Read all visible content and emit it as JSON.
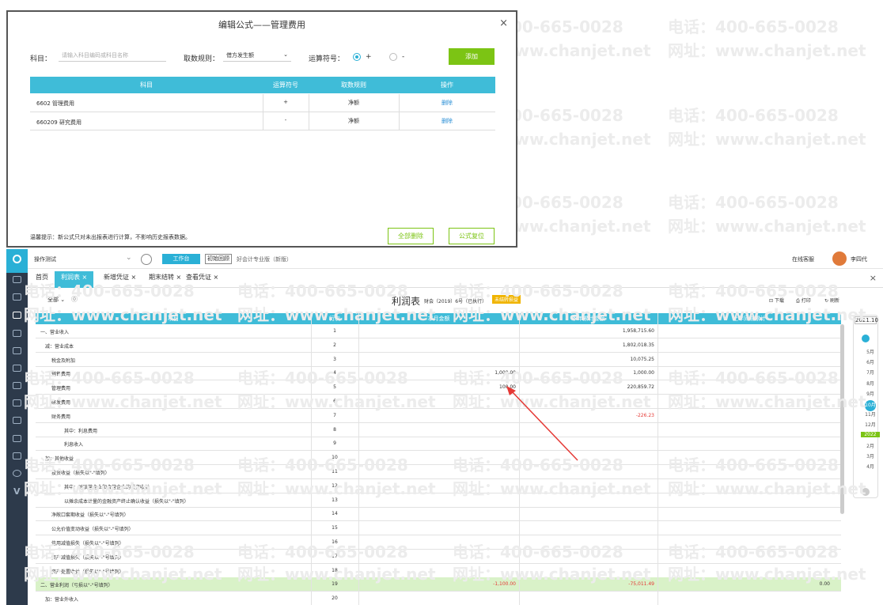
{
  "watermark": {
    "phone": "电话：400-665-0028",
    "site": "网址：www.chanjet.net"
  },
  "dialog": {
    "title": "编辑公式——管理费用",
    "close": "×",
    "subject_label": "科目：",
    "subject_placeholder": "请输入科目编码或科目名称",
    "rule_label": "取数规则：",
    "rule_value": "借方发生额",
    "op_label": "运算符号：",
    "op_plus": "+",
    "op_minus": "-",
    "add_button": "添加",
    "columns": [
      "科目",
      "运算符号",
      "取数规则",
      "操作"
    ],
    "rows": [
      {
        "subject": "6602 管理费用",
        "op": "+",
        "rule": "净额",
        "action": "删除"
      },
      {
        "subject": "660209 研究费用",
        "op": "-",
        "rule": "净额",
        "action": "删除"
      }
    ],
    "hint": "温馨提示：新公式只对未出报表进行计算，不影响历史报表数据。",
    "delete_all": "全部删除",
    "reset_formula": "公式复位"
  },
  "topbar": {
    "company": "操作测试",
    "workbench": "工作台",
    "initial": "初始回顾",
    "version": "好会计专业版（新版）",
    "help": "在线客服",
    "user": "李四代"
  },
  "tabs": [
    {
      "label": "首页"
    },
    {
      "label": "利润表 ×"
    },
    {
      "label": "新增凭证 ×"
    },
    {
      "label": "期末结转 ×"
    },
    {
      "label": "查看凭证 ×"
    }
  ],
  "report": {
    "scope": "全部",
    "title": "利润表",
    "subtitle": "财会（2019）6号（已执行）",
    "badge": "未结转损益",
    "download": "下载",
    "print": "打印",
    "refresh": "刷新",
    "columns": [
      "项目",
      "行次",
      "本月金额",
      "本年累计金额",
      "上年同期累计"
    ],
    "rows": [
      {
        "item": "一、营业收入",
        "no": "1",
        "m": "",
        "y": "1,958,715.60",
        "p": ""
      },
      {
        "item": "减：营业成本",
        "no": "2",
        "m": "",
        "y": "1,802,018.35",
        "p": ""
      },
      {
        "item": "税金及附加",
        "no": "3",
        "m": "",
        "y": "10,075.25",
        "p": ""
      },
      {
        "item": "销售费用",
        "no": "4",
        "m": "1,000.00",
        "y": "1,000.00",
        "p": ""
      },
      {
        "item": "管理费用",
        "no": "5",
        "m": "100.00",
        "y": "220,859.72",
        "p": ""
      },
      {
        "item": "研发费用",
        "no": "6",
        "m": "",
        "y": "",
        "p": ""
      },
      {
        "item": "财务费用",
        "no": "7",
        "m": "",
        "y": "-226.23",
        "p": ""
      },
      {
        "item": "其中：利息费用",
        "no": "8",
        "m": "",
        "y": "",
        "p": ""
      },
      {
        "item": "利息收入",
        "no": "9",
        "m": "",
        "y": "",
        "p": ""
      },
      {
        "item": "加：其他收益",
        "no": "10",
        "m": "",
        "y": "",
        "p": ""
      },
      {
        "item": "投资收益（损失以\"-\"填列）",
        "no": "11",
        "m": "",
        "y": "",
        "p": ""
      },
      {
        "item": "其中：对联营企业和合营企业的投资收益",
        "no": "12",
        "m": "",
        "y": "",
        "p": ""
      },
      {
        "item": "以摊余成本计量的金融资产终止确认收益（损失以\"-\"填列）",
        "no": "13",
        "m": "",
        "y": "",
        "p": ""
      },
      {
        "item": "净敞口套期收益（损失以\"-\"号填列）",
        "no": "14",
        "m": "",
        "y": "",
        "p": ""
      },
      {
        "item": "公允价值变动收益（损失以\"-\"号填列）",
        "no": "15",
        "m": "",
        "y": "",
        "p": ""
      },
      {
        "item": "信用减值损失（损失以\"-\"号填列）",
        "no": "16",
        "m": "",
        "y": "",
        "p": ""
      },
      {
        "item": "资产减值损失（损失以\"-\"号填列）",
        "no": "17",
        "m": "",
        "y": "",
        "p": ""
      },
      {
        "item": "资产处置收益（损失以\"-\"号填列）",
        "no": "18",
        "m": "",
        "y": "",
        "p": ""
      },
      {
        "item": "二、营业利润（亏损以\"-\"号填列）",
        "no": "19",
        "m": "-1,100.00",
        "y": "-75,011.49",
        "p": "0.00"
      },
      {
        "item": "加：营业外收入",
        "no": "20",
        "m": "",
        "y": "",
        "p": ""
      }
    ]
  },
  "period": {
    "current": "2021.10",
    "months": [
      "5月",
      "6月",
      "7月",
      "8月",
      "9月",
      "10月",
      "11月",
      "12月",
      "2022",
      "2月",
      "3月",
      "4月"
    ]
  }
}
